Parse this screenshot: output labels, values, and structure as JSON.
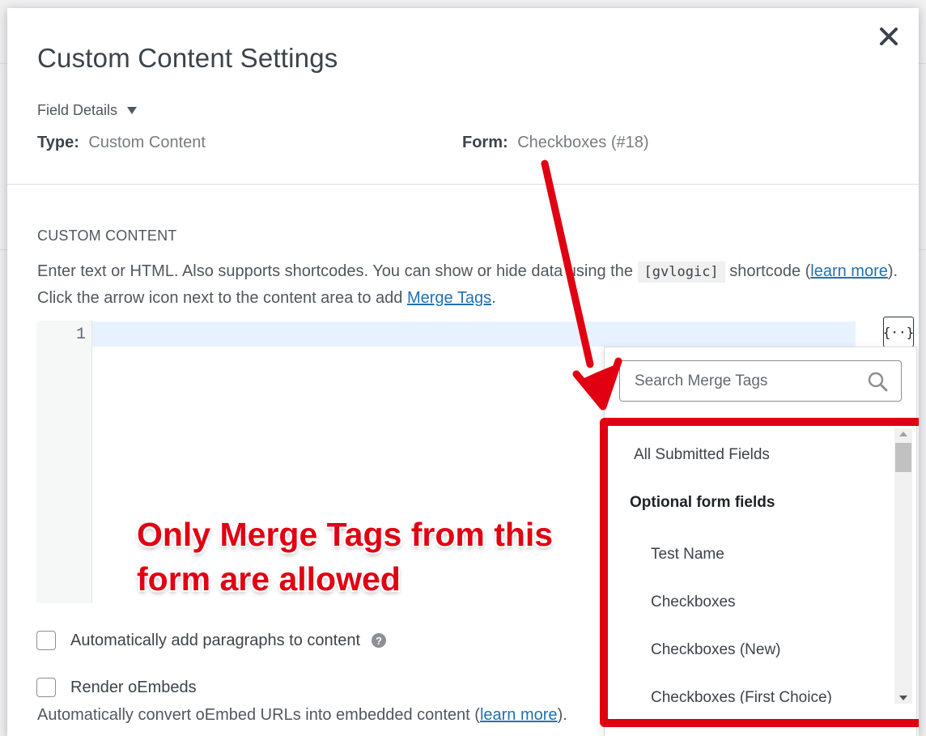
{
  "modal": {
    "title": "Custom Content Settings",
    "field_details_label": "Field Details",
    "type_label": "Type:",
    "type_value": "Custom Content",
    "form_label": "Form:",
    "form_value": "Checkboxes (#18)"
  },
  "custom_content": {
    "section_label": "CUSTOM CONTENT",
    "desc_part1": "Enter text or HTML. Also supports shortcodes. You can show or hide data using the ",
    "code": "[gvlogic]",
    "desc_part2": " shortcode (",
    "learn_more": "learn more",
    "desc_part3": "). Click the arrow icon next to the content area to add ",
    "merge_tags_link": "Merge Tags",
    "desc_part4": ".",
    "line_number": "1",
    "merge_button_label": "{··}"
  },
  "merge_dropdown": {
    "search_placeholder": "Search Merge Tags",
    "all_submitted": "All Submitted Fields",
    "group_heading": "Optional form fields",
    "items": [
      "Test Name",
      "Checkboxes",
      "Checkboxes (New)",
      "Checkboxes (First Choice)"
    ]
  },
  "annotation": {
    "callout_text": "Only Merge Tags from this form are allowed",
    "color": "#e00012"
  },
  "options": {
    "auto_paragraphs": "Automatically add paragraphs to content",
    "render_oembeds": "Render oEmbeds",
    "oembed_desc_part1": "Automatically convert oEmbed URLs into embedded content (",
    "oembed_learn_more": "learn more",
    "oembed_desc_part2": ")."
  }
}
